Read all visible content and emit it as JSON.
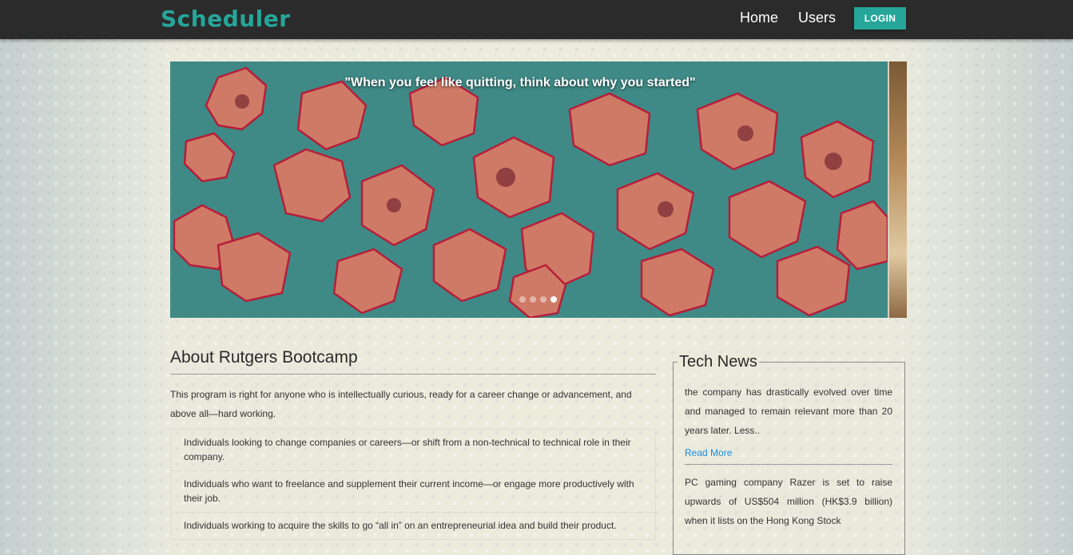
{
  "navbar": {
    "brand": "Scheduler",
    "links": [
      "Home",
      "Users"
    ],
    "login_label": "LOGIN"
  },
  "carousel": {
    "quote": "\"When you feel like quitting, think about why you started\"",
    "slide_count": 4,
    "active_slide": 4
  },
  "about": {
    "title": "About Rutgers Bootcamp",
    "intro": "This program is right for anyone who is intellectually curious, ready for a career change or advancement, and above all—hard working.",
    "items": [
      "Individuals looking to change companies or careers—or shift from a non-technical to technical role in their company.",
      "Individuals who want to freelance and supplement their current income—or engage more productively with their job.",
      "Individuals working to acquire the skills to go “all in” on an entrepreneurial idea and build their product."
    ]
  },
  "news": {
    "title": "Tech News",
    "articles": [
      {
        "text": "the company has drastically evolved over time and managed to remain relevant more than 20 years later. Less..",
        "link": "Read More"
      },
      {
        "text": "PC gaming company Razer is set to raise upwards of US$504 million (HK$3.9 billion) when it lists on the Hong Kong Stock"
      }
    ]
  },
  "colors": {
    "accent": "#26a69a",
    "navbar": "#2b2b2b",
    "link": "#1a8ce0"
  }
}
